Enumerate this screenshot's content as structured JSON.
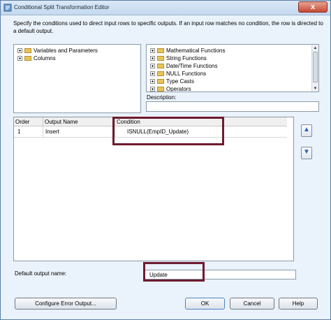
{
  "window": {
    "title": "Conditional Split Transformation Editor",
    "close_glyph": "x"
  },
  "description": "Specify the conditions used to direct input rows to specific outputs. If an input row matches no condition, the row is directed to a default output.",
  "left_tree": {
    "items": [
      {
        "label": "Variables and Parameters",
        "icon": "folder-icon"
      },
      {
        "label": "Columns",
        "icon": "folder-icon"
      }
    ]
  },
  "right_tree": {
    "items": [
      {
        "label": "Mathematical Functions",
        "icon": "folder-icon"
      },
      {
        "label": "String Functions",
        "icon": "folder-icon"
      },
      {
        "label": "Date/Time Functions",
        "icon": "folder-icon"
      },
      {
        "label": "NULL Functions",
        "icon": "folder-icon"
      },
      {
        "label": "Type Casts",
        "icon": "folder-icon"
      },
      {
        "label": "Operators",
        "icon": "folder-icon"
      }
    ]
  },
  "description_panel": {
    "label": "Description:",
    "value": ""
  },
  "grid": {
    "columns": [
      "Order",
      "Output Name",
      "Condition"
    ],
    "rows": [
      {
        "order": "1",
        "output_name": "Insert",
        "condition": "ISNULL(EmpID_Update)"
      }
    ]
  },
  "side_buttons": {
    "up_glyph": "▲",
    "down_glyph": "▼"
  },
  "default_output": {
    "label": "Default output name:",
    "value": "Update"
  },
  "buttons": {
    "configure": "Configure Error Output...",
    "ok": "OK",
    "cancel": "Cancel",
    "help": "Help"
  },
  "colors": {
    "highlight": "#6e1b2f",
    "window_bg": "#eaf2fb"
  }
}
